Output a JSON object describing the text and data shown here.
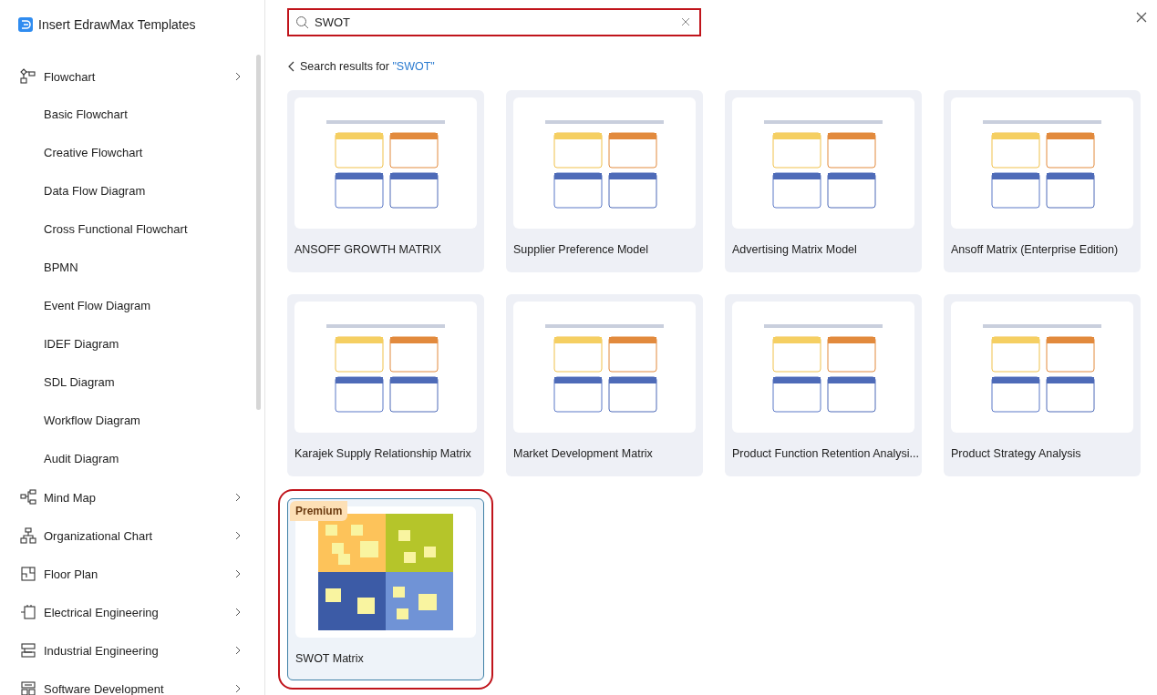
{
  "app": {
    "title": "Insert EdrawMax Templates"
  },
  "sidebar": {
    "items": [
      {
        "label": "Flowchart",
        "children": [
          {
            "label": "Basic Flowchart"
          },
          {
            "label": "Creative Flowchart"
          },
          {
            "label": "Data Flow Diagram"
          },
          {
            "label": "Cross Functional Flowchart"
          },
          {
            "label": "BPMN"
          },
          {
            "label": "Event Flow Diagram"
          },
          {
            "label": "IDEF Diagram"
          },
          {
            "label": "SDL Diagram"
          },
          {
            "label": "Workflow Diagram"
          },
          {
            "label": "Audit Diagram"
          }
        ]
      },
      {
        "label": "Mind Map"
      },
      {
        "label": "Organizational Chart"
      },
      {
        "label": "Floor Plan"
      },
      {
        "label": "Electrical Engineering"
      },
      {
        "label": "Industrial Engineering"
      },
      {
        "label": "Software Development"
      }
    ]
  },
  "search": {
    "value": "SWOT"
  },
  "results": {
    "label": "Search results for ",
    "query": "\"SWOT\""
  },
  "templates": [
    {
      "title": "ANSOFF GROWTH MATRIX",
      "kind": "matrix",
      "premium": false,
      "selected": false
    },
    {
      "title": "Supplier Preference Model",
      "kind": "matrix",
      "premium": false,
      "selected": false
    },
    {
      "title": "Advertising Matrix Model",
      "kind": "matrix",
      "premium": false,
      "selected": false
    },
    {
      "title": "Ansoff Matrix (Enterprise Edition)",
      "kind": "matrix",
      "premium": false,
      "selected": false
    },
    {
      "title": "Karajek Supply Relationship Matrix",
      "kind": "matrix",
      "premium": false,
      "selected": false
    },
    {
      "title": "Market Development Matrix",
      "kind": "matrix",
      "premium": false,
      "selected": false
    },
    {
      "title": "Product Function Retention Analysi...",
      "kind": "matrix",
      "premium": false,
      "selected": false
    },
    {
      "title": "Product Strategy Analysis",
      "kind": "matrix",
      "premium": false,
      "selected": false
    },
    {
      "title": "SWOT Matrix",
      "kind": "sticky",
      "premium": true,
      "premium_label": "Premium",
      "selected": true
    }
  ]
}
